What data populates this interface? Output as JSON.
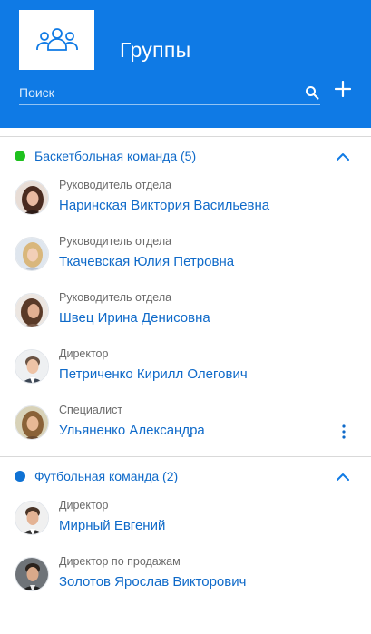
{
  "header": {
    "title": "Группы",
    "search_placeholder": "Поиск",
    "background_color": "#0f7ae5",
    "logo_icon": "users-group-icon",
    "search_icon": "search-icon",
    "add_icon": "plus-icon"
  },
  "groups": [
    {
      "title": "Баскетбольная команда (5)",
      "dot_color": "#1ec11e",
      "title_color": "#0f6ac9",
      "expanded": true,
      "members": [
        {
          "role": "Руководитель отдела",
          "name": "Наринская Виктория Васильевна"
        },
        {
          "role": "Руководитель отдела",
          "name": "Ткачевская Юлия Петровна"
        },
        {
          "role": "Руководитель отдела",
          "name": "Швец Ирина Денисовна"
        },
        {
          "role": "Директор",
          "name": "Петриченко Кирилл Олегович"
        },
        {
          "role": "Специалист",
          "name": "Ульяненко Александра"
        }
      ]
    },
    {
      "title": "Футбольная команда (2)",
      "dot_color": "#0f72d4",
      "title_color": "#0f6ac9",
      "expanded": true,
      "members": [
        {
          "role": "Директор",
          "name": "Мирный Евгений"
        },
        {
          "role": "Директор по продажам",
          "name": "Золотов Ярослав Викторович"
        }
      ]
    }
  ]
}
